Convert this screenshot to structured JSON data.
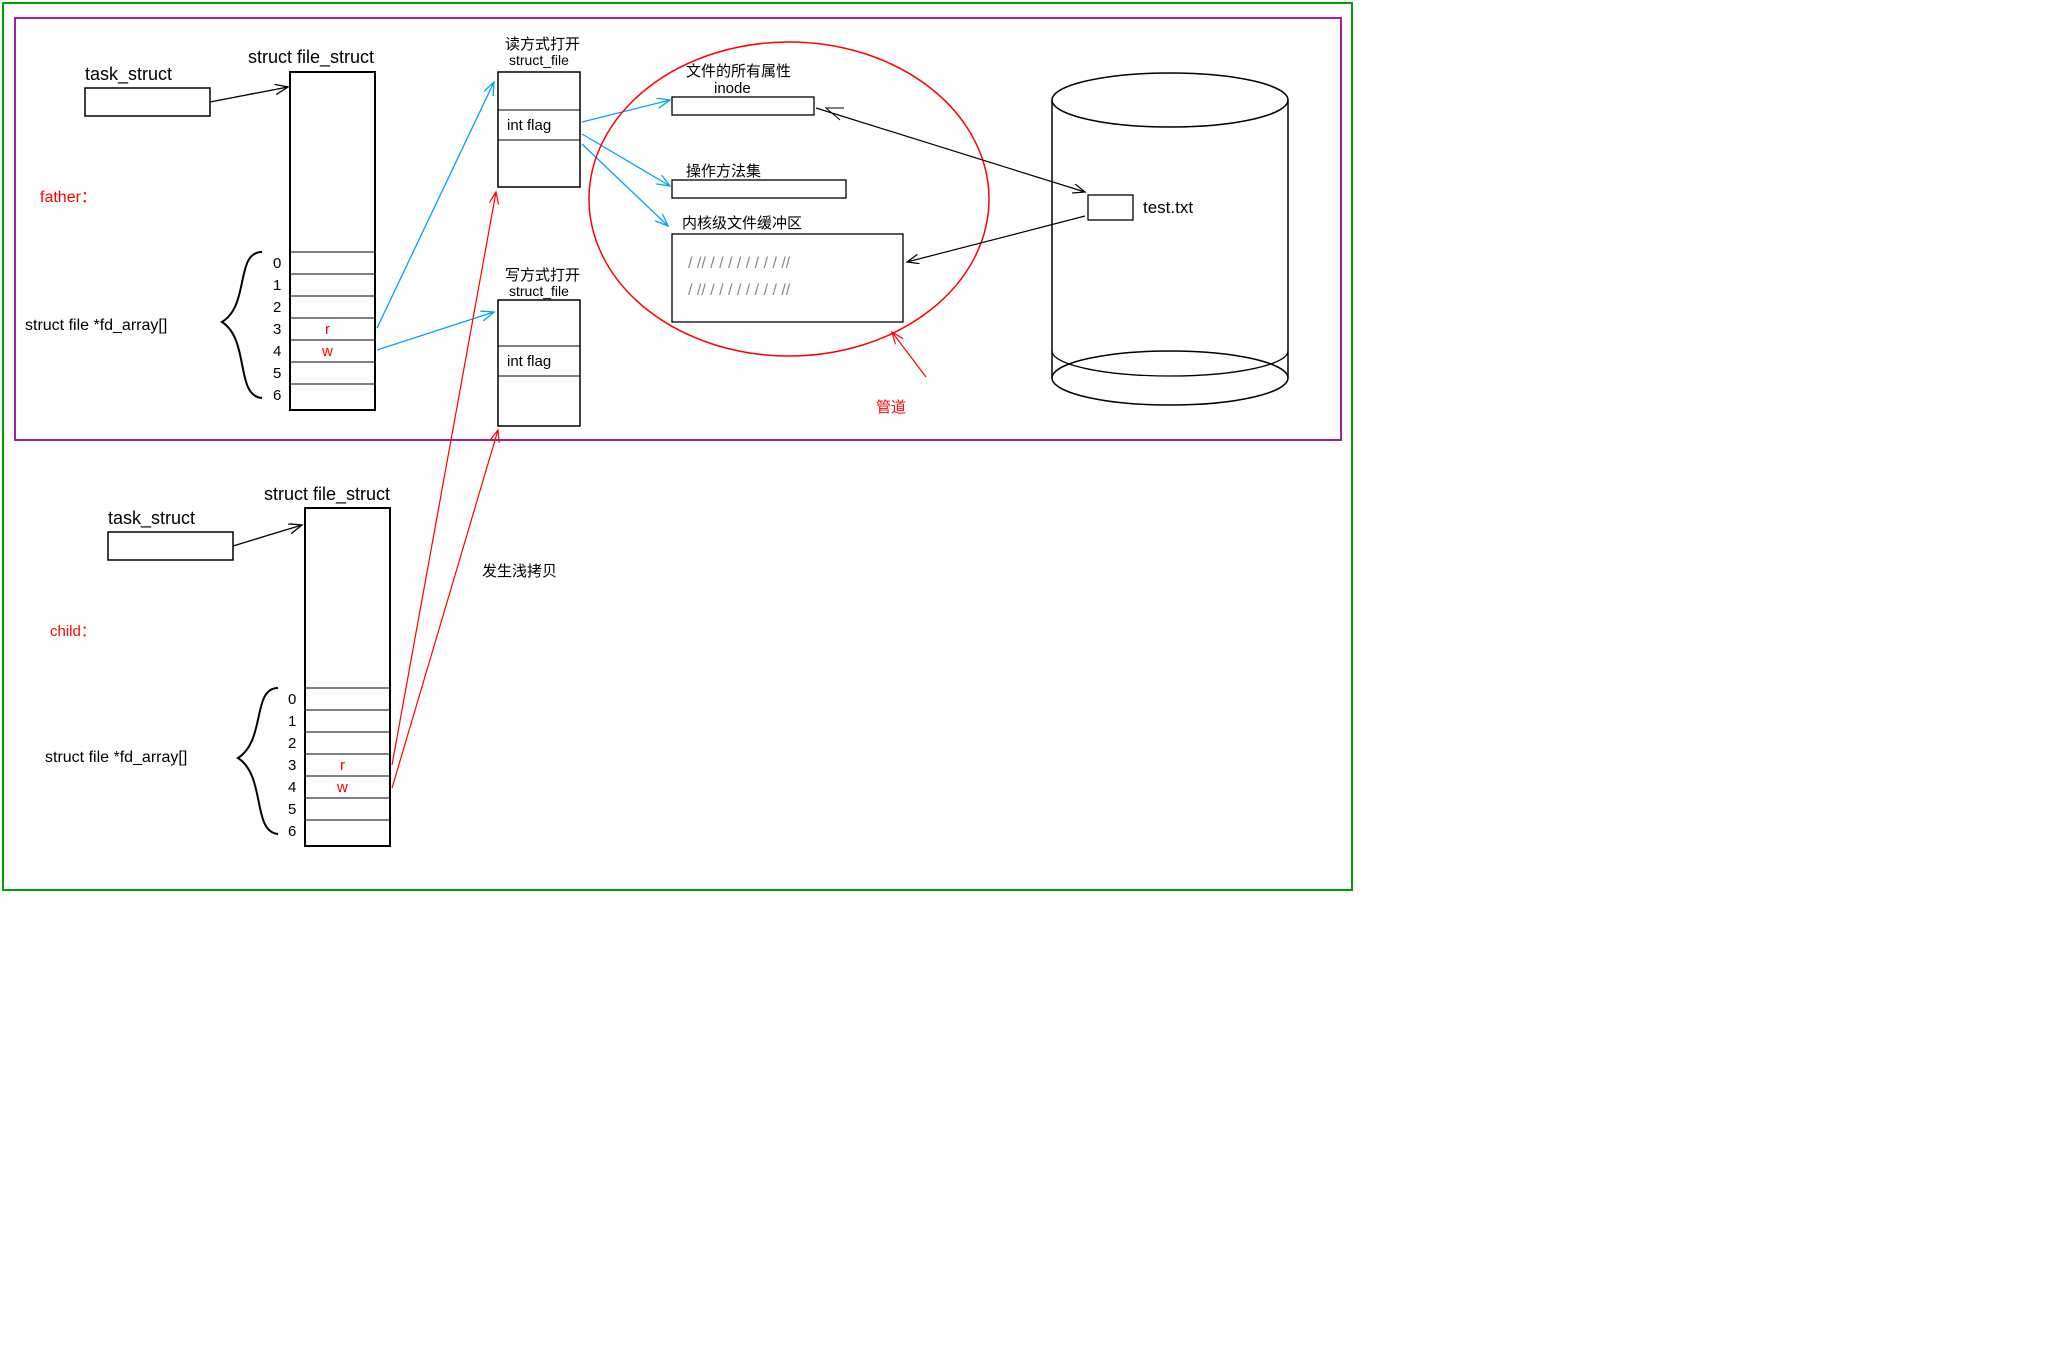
{
  "labels": {
    "task_struct_1": "task_struct",
    "task_struct_2": "task_struct",
    "file_struct_1": "struct file_struct",
    "file_struct_2": "struct file_struct",
    "father": "father：",
    "child": "child：",
    "fd_array_1": "struct file *fd_array[]",
    "fd_array_2": "struct file *fd_array[]",
    "row_r_1": "r",
    "row_w_1": "w",
    "row_r_2": "r",
    "row_w_2": "w",
    "idx0a": "0",
    "idx1a": "1",
    "idx2a": "2",
    "idx3a": "3",
    "idx4a": "4",
    "idx5a": "5",
    "idx6a": "6",
    "idx0b": "0",
    "idx1b": "1",
    "idx2b": "2",
    "idx3b": "3",
    "idx4b": "4",
    "idx5b": "5",
    "idx6b": "6",
    "read_open": "读方式打开",
    "write_open": "写方式打开",
    "struct_file_1": "struct_file",
    "struct_file_2": "struct_file",
    "int_flag_1": "int flag",
    "int_flag_2": "int flag",
    "file_all_attr": "文件的所有属性",
    "inode": "inode",
    "method_set": "操作方法集",
    "kernel_buffer": "内核级文件缓冲区",
    "buffer_line1": "/ //  / /  / / / / / /  //",
    "buffer_line2": "/ //  / /  / / / / / /  //",
    "pipe": "管道",
    "shallow_copy": "发生浅拷贝",
    "test_txt": "test.txt"
  },
  "colors": {
    "outer_border": "#00a000",
    "inner_border": "#a020a0",
    "red": "#ff0000",
    "blue": "#00a0ff",
    "black": "#000000",
    "gray": "#888888"
  }
}
